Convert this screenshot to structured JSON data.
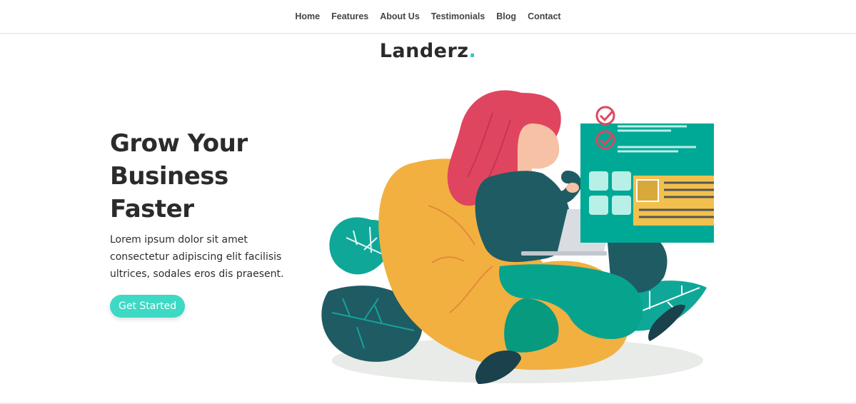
{
  "nav": {
    "items": [
      {
        "label": "Home"
      },
      {
        "label": "Features"
      },
      {
        "label": "About Us"
      },
      {
        "label": "Testimonials"
      },
      {
        "label": "Blog"
      },
      {
        "label": "Contact"
      }
    ]
  },
  "brand": {
    "name": "Landerz",
    "dot": ".",
    "dot_color": "#35c9b4"
  },
  "hero": {
    "title_lines": [
      "Grow Your",
      "Business",
      "Faster"
    ],
    "description": "Lorem ipsum dolor sit amet consectetur adipiscing elit facilisis ultrices, sodales eros dis praesent.",
    "cta_label": "Get Started",
    "cta_color": "#3dd9c4"
  },
  "illustration": {
    "icon": "woman-with-laptop-illustration",
    "colors": {
      "teal": "#00a896",
      "dark_teal": "#1e5b62",
      "hair": "#e0455f",
      "beanbag": "#f2b041",
      "card_yellow": "#f2c04d"
    }
  }
}
